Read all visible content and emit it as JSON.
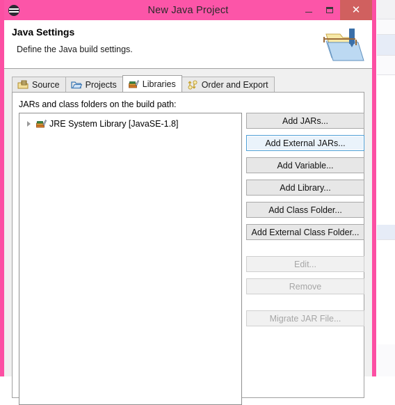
{
  "window": {
    "title": "New Java Project",
    "app_icon": "eclipse-icon",
    "accent_color": "#fc55a8",
    "close_button_color": "#d0605f",
    "controls": {
      "minimize_label": "–",
      "maximize_label": "❑",
      "close_label": "✕"
    }
  },
  "header": {
    "title": "Java Settings",
    "description": "Define the Java build settings.",
    "banner_icon": "java-project-folder-banner-icon"
  },
  "tabs": [
    {
      "label": "Source",
      "icon": "source-package-icon",
      "active": false
    },
    {
      "label": "Projects",
      "icon": "projects-folder-icon",
      "active": false
    },
    {
      "label": "Libraries",
      "icon": "libraries-books-icon",
      "active": true
    },
    {
      "label": "Order and Export",
      "icon": "order-export-arrows-icon",
      "active": false
    }
  ],
  "libraries_panel": {
    "list_label": "JARs and class folders on the build path:",
    "tree_items": [
      {
        "label": "JRE System Library [JavaSE-1.8]",
        "icon": "jre-library-icon",
        "expandable": true,
        "expanded": false
      }
    ],
    "buttons": [
      {
        "label": "Add JARs...",
        "state": "normal",
        "gap_before": false
      },
      {
        "label": "Add External JARs...",
        "state": "focused",
        "gap_before": false
      },
      {
        "label": "Add Variable...",
        "state": "normal",
        "gap_before": false
      },
      {
        "label": "Add Library...",
        "state": "normal",
        "gap_before": false
      },
      {
        "label": "Add Class Folder...",
        "state": "normal",
        "gap_before": false
      },
      {
        "label": "Add External Class Folder...",
        "state": "normal",
        "gap_before": false
      },
      {
        "label": "Edit...",
        "state": "disabled",
        "gap_before": true
      },
      {
        "label": "Remove",
        "state": "disabled",
        "gap_before": false
      },
      {
        "label": "Migrate JAR File...",
        "state": "disabled",
        "gap_before": true
      }
    ]
  }
}
